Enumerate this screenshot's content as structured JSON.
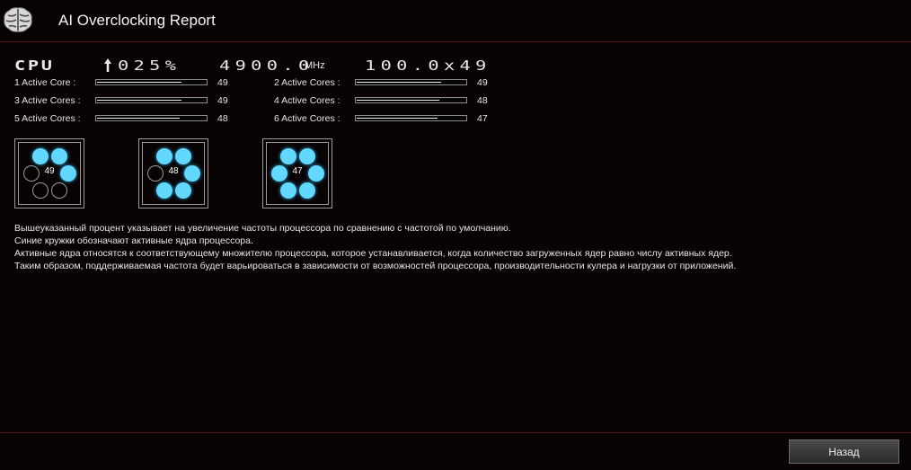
{
  "window": {
    "title": "AI Overclocking Report"
  },
  "cpu": {
    "label": "CPU",
    "percent": "025%",
    "frequency": "4900.0",
    "frequency_unit": "MHz",
    "multiplier": "100.0x49"
  },
  "cores": [
    {
      "label": "1 Active Core :",
      "value": "49",
      "fill": 0.78
    },
    {
      "label": "2 Active Cores :",
      "value": "49",
      "fill": 0.78
    },
    {
      "label": "3 Active Cores :",
      "value": "49",
      "fill": 0.78
    },
    {
      "label": "4 Active Cores :",
      "value": "48",
      "fill": 0.76
    },
    {
      "label": "5 Active Cores :",
      "value": "48",
      "fill": 0.76
    },
    {
      "label": "6 Active Cores :",
      "value": "47",
      "fill": 0.74
    }
  ],
  "diagrams": [
    {
      "value": "49",
      "active": [
        true,
        true,
        false,
        true,
        false,
        false
      ]
    },
    {
      "value": "48",
      "active": [
        true,
        true,
        false,
        true,
        true,
        true
      ]
    },
    {
      "value": "47",
      "active": [
        true,
        true,
        true,
        true,
        true,
        true
      ]
    }
  ],
  "description": {
    "line1": "Вышеуказанный процент указывает на увеличение частоты процессора по сравнению с частотой по умолчанию.",
    "line2": "Синие кружки обозначают активные ядра процессора.",
    "line3": "Активные ядра относятся к соответствующему множителю процессора, которое устанавливается, когда количество загруженных ядер равно числу активных ядер.",
    "line4": "Таким образом, поддерживаемая частота будет варьироваться в зависимости от возможностей процессора, производительности кулера и нагрузки от приложений."
  },
  "footer": {
    "back_label": "Назад"
  },
  "icons": {
    "app": "brain-icon",
    "percent": "arrow-up-icon"
  },
  "colors": {
    "accent": "#5a1218",
    "active_core": "#62d8ff",
    "background": "#080203"
  }
}
